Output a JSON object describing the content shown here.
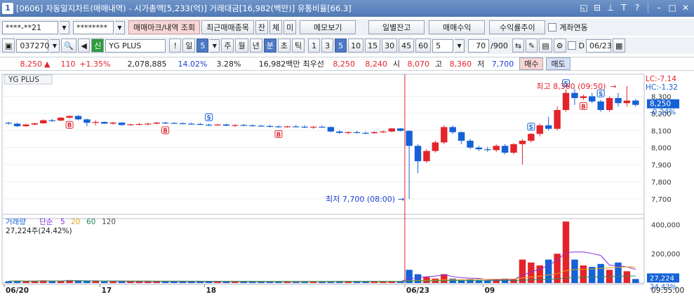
{
  "window": {
    "number": "1",
    "title": "[0606] 자동일지차트(매매내역) - 시가총액[5,233(억)] 거래대금[16,982(백만)] 유통비율[66.3]"
  },
  "toolbar1": {
    "account": "****-**21",
    "password": "********",
    "trade_mark_btn": "매매마크/내역 조회",
    "recent_btn": "최근매매종목",
    "jan_btn": "잔",
    "che_btn": "체",
    "mi_btn": "미",
    "memo_btn": "메모보기",
    "daily_balance_btn": "일별잔고",
    "trade_profit_btn": "매매수익",
    "return_trend_btn": "수익률추이",
    "account_link_label": "계좌연동"
  },
  "toolbar2": {
    "code": "037270",
    "stock_badge": "신",
    "stock_name": "YG PLUS",
    "alert": "!",
    "period_label": "일",
    "period_value": "5",
    "periods": [
      "주",
      "월",
      "년"
    ],
    "selected_period": "분",
    "other_periods": [
      "초",
      "틱"
    ],
    "intervals": [
      "1",
      "3",
      "5",
      "10",
      "15",
      "30",
      "45",
      "60"
    ],
    "interval_input": "5",
    "count": "70",
    "count_total": "/900",
    "date_prefix": "D",
    "date": "06/23"
  },
  "quote": {
    "price": "8,250",
    "arrow": "▲",
    "change": "110",
    "change_pct": "+1.35%",
    "volume": "2,078,885",
    "vol_ratio": "14.02%",
    "ratio2": "3.28%",
    "amount": "16,982백만",
    "best_label": "최우선",
    "ask": "8,250",
    "bid": "8,240",
    "open_label": "시",
    "open": "8,070",
    "high_label": "고",
    "high": "8,360",
    "low_label": "저",
    "low": "7,700",
    "buy_btn": "매수",
    "sell_btn": "매도"
  },
  "colors": {
    "up": "#e3242b",
    "down": "#1462d6",
    "ma": "#8a2be2",
    "ma20": "#e8a317",
    "ma60": "#2e8b57",
    "ma120": "#555555"
  },
  "chart_data": {
    "type": "candlestick",
    "title": "YG PLUS",
    "interval": "5분",
    "y_axis_labels": [
      "8,300",
      "8,200",
      "8,100",
      "8,000",
      "7,900",
      "7,800",
      "7,700"
    ],
    "price_range": [
      7650,
      8380
    ],
    "lc_label": "LC:-7.14",
    "hc_label": "HC:-1.32",
    "current_price_label": "8,250",
    "current_pct_label": "-0.24%",
    "high_annotation": "최고 8,360 (09:50)",
    "low_annotation": "최저 7,700 (08:00)",
    "x_labels": [
      {
        "index": 0,
        "label": "06/20"
      },
      {
        "index": 11,
        "label": "17"
      },
      {
        "index": 23,
        "label": "18"
      },
      {
        "index": 46,
        "label": "06/23"
      },
      {
        "index": 55,
        "label": "09"
      }
    ],
    "time_label": "09:55:00",
    "candles": [
      [
        8145,
        8150,
        8135,
        8140
      ],
      [
        8140,
        8145,
        8120,
        8125
      ],
      [
        8125,
        8140,
        8120,
        8135
      ],
      [
        8135,
        8145,
        8130,
        8142
      ],
      [
        8142,
        8165,
        8140,
        8160
      ],
      [
        8160,
        8168,
        8150,
        8158
      ],
      [
        8158,
        8178,
        8155,
        8175
      ],
      [
        8175,
        8188,
        8170,
        8185
      ],
      [
        8185,
        8190,
        8160,
        8165
      ],
      [
        8165,
        8170,
        8125,
        8145
      ],
      [
        8145,
        8160,
        8130,
        8150
      ],
      [
        8150,
        8152,
        8138,
        8140
      ],
      [
        8140,
        8150,
        8135,
        8146
      ],
      [
        8146,
        8148,
        8128,
        8132
      ],
      [
        8132,
        8140,
        8128,
        8136
      ],
      [
        8136,
        8144,
        8130,
        8138
      ],
      [
        8138,
        8145,
        8130,
        8140
      ],
      [
        8140,
        8150,
        8136,
        8146
      ],
      [
        8146,
        8150,
        8138,
        8144
      ],
      [
        8144,
        8148,
        8140,
        8142
      ],
      [
        8142,
        8148,
        8136,
        8140
      ],
      [
        8140,
        8146,
        8134,
        8138
      ],
      [
        8138,
        8145,
        8130,
        8134
      ],
      [
        8134,
        8140,
        8126,
        8130
      ],
      [
        8130,
        8138,
        8128,
        8135
      ],
      [
        8135,
        8140,
        8126,
        8128
      ],
      [
        8128,
        8136,
        8120,
        8132
      ],
      [
        8132,
        8138,
        8126,
        8130
      ],
      [
        8130,
        8136,
        8124,
        8128
      ],
      [
        8128,
        8134,
        8122,
        8126
      ],
      [
        8126,
        8134,
        8118,
        8124
      ],
      [
        8124,
        8130,
        8116,
        8120
      ],
      [
        8120,
        8128,
        8116,
        8124
      ],
      [
        8124,
        8132,
        8118,
        8122
      ],
      [
        8122,
        8130,
        8114,
        8118
      ],
      [
        8118,
        8126,
        8110,
        8122
      ],
      [
        8122,
        8128,
        8116,
        8120
      ],
      [
        8120,
        8124,
        8090,
        8094
      ],
      [
        8094,
        8102,
        8080,
        8086
      ],
      [
        8086,
        8094,
        8078,
        8090
      ],
      [
        8090,
        8098,
        8082,
        8086
      ],
      [
        8086,
        8094,
        8078,
        8084
      ],
      [
        8084,
        8094,
        8080,
        8090
      ],
      [
        8090,
        8100,
        8084,
        8094
      ],
      [
        8094,
        8116,
        8090,
        8112
      ],
      [
        8112,
        8114,
        8094,
        8098
      ],
      [
        8098,
        8100,
        7700,
        8010
      ],
      [
        8010,
        8020,
        7850,
        7920
      ],
      [
        7920,
        7990,
        7910,
        7980
      ],
      [
        7980,
        8040,
        7970,
        8030
      ],
      [
        8030,
        8130,
        8020,
        8120
      ],
      [
        8120,
        8128,
        8080,
        8090
      ],
      [
        8090,
        8095,
        8020,
        8040
      ],
      [
        8040,
        8050,
        7990,
        8000
      ],
      [
        8000,
        8010,
        7980,
        7990
      ],
      [
        7990,
        8005,
        7975,
        7985
      ],
      [
        7985,
        8020,
        7975,
        8010
      ],
      [
        8010,
        8020,
        7960,
        7970
      ],
      [
        7970,
        8025,
        7960,
        8020
      ],
      [
        8020,
        8050,
        7900,
        8040
      ],
      [
        8040,
        8085,
        8030,
        8080
      ],
      [
        8080,
        8140,
        8065,
        8130
      ],
      [
        8130,
        8180,
        8100,
        8110
      ],
      [
        8110,
        8240,
        8100,
        8220
      ],
      [
        8220,
        8340,
        8210,
        8320
      ],
      [
        8320,
        8345,
        8250,
        8290
      ],
      [
        8290,
        8310,
        8280,
        8300
      ],
      [
        8300,
        8320,
        8260,
        8270
      ],
      [
        8270,
        8280,
        8210,
        8220
      ],
      [
        8220,
        8300,
        8210,
        8290
      ],
      [
        8290,
        8320,
        8240,
        8260
      ],
      [
        8260,
        8360,
        8240,
        8275
      ],
      [
        8275,
        8285,
        8240,
        8250
      ]
    ],
    "markers": [
      {
        "index": 7,
        "type": "B"
      },
      {
        "index": 18,
        "type": "B"
      },
      {
        "index": 23,
        "type": "S"
      },
      {
        "index": 31,
        "type": "B"
      },
      {
        "index": 60,
        "type": "S"
      },
      {
        "index": 64,
        "type": "S"
      },
      {
        "index": 66,
        "type": "B"
      },
      {
        "index": 68,
        "type": "S"
      }
    ],
    "volume": {
      "label": "거래량",
      "ma_labels": [
        "단순",
        "5",
        "20",
        "60",
        "120"
      ],
      "current_text": "27,224주(24.42%)",
      "y_axis_labels": [
        "400,000",
        "200,000"
      ],
      "current_value_label": "27,224",
      "current_pct_label": "24.42%",
      "range": [
        0,
        450000
      ],
      "values": [
        12000,
        15000,
        11000,
        14000,
        18000,
        12000,
        16000,
        20000,
        14000,
        13000,
        12000,
        11000,
        10000,
        12000,
        11000,
        10000,
        9000,
        11000,
        12000,
        10000,
        9000,
        10000,
        11000,
        9000,
        10000,
        9000,
        8000,
        11000,
        9000,
        10000,
        8000,
        9000,
        10000,
        8000,
        9000,
        11000,
        10000,
        12000,
        14000,
        11000,
        10000,
        9000,
        12000,
        10000,
        11000,
        13000,
        90000,
        60000,
        40000,
        30000,
        60000,
        30000,
        20000,
        25000,
        20000,
        18000,
        25000,
        30000,
        25000,
        160000,
        140000,
        120000,
        160000,
        200000,
        420000,
        160000,
        120000,
        110000,
        130000,
        90000,
        140000,
        80000,
        27224
      ]
    }
  }
}
